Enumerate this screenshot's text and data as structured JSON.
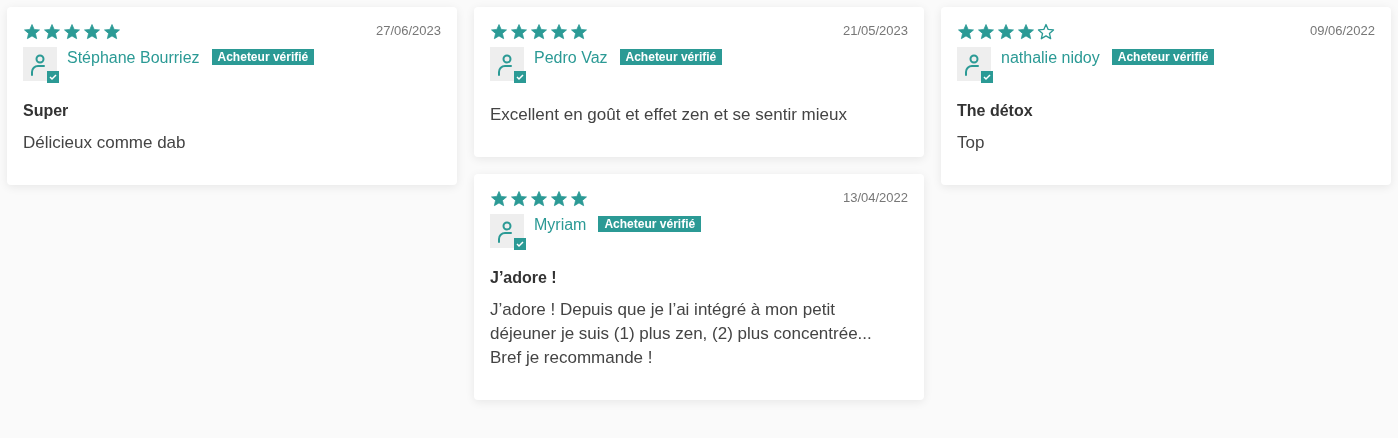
{
  "columns": [
    [
      {
        "stars": 5,
        "date": "27/06/2023",
        "name": "Stéphane Bourriez",
        "badge": "Acheteur vérifié",
        "title": "Super",
        "body": "Délicieux comme dab"
      }
    ],
    [
      {
        "stars": 5,
        "date": "21/05/2023",
        "name": "Pedro Vaz",
        "badge": "Acheteur vérifié",
        "body": "Excellent en goût et effet zen et se sentir mieux"
      },
      {
        "stars": 5,
        "date": "13/04/2022",
        "name": "Myriam",
        "badge": "Acheteur vérifié",
        "title": "J’adore !",
        "body": "J’adore ! Depuis que je l’ai intégré à mon petit déjeuner je suis (1) plus zen, (2) plus concentrée... Bref je recommande !"
      }
    ],
    [
      {
        "stars": 4,
        "date": "09/06/2022",
        "name": "nathalie nidoy",
        "badge": "Acheteur vérifié",
        "title": "The détox",
        "body": "Top"
      }
    ]
  ]
}
